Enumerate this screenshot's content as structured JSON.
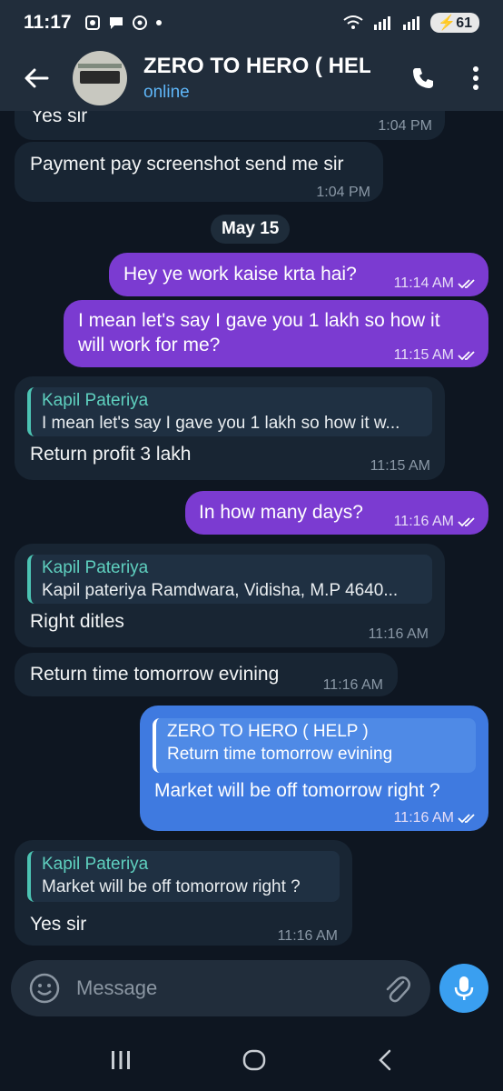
{
  "status_bar": {
    "time": "11:17",
    "battery": "61"
  },
  "header": {
    "title": "ZERO TO HERO ( HEL",
    "status": "online"
  },
  "date_chip": "May 15",
  "messages": [
    {
      "text": "Yes sir",
      "time": "1:04 PM"
    },
    {
      "text": "Payment pay screenshot send me sir",
      "time": "1:04 PM"
    },
    {
      "text": "Hey ye work kaise krta hai?",
      "time": "11:14 AM"
    },
    {
      "text_line1": "I mean let's say I gave you 1 lakh so how it",
      "text_line2": "will work for me?",
      "time": "11:15 AM"
    },
    {
      "quote_name": "Kapil Pateriya",
      "quote_text": "I mean let's say I gave you 1 lakh so how it w...",
      "text": "Return profit 3 lakh",
      "time": "11:15 AM"
    },
    {
      "text": "In how many days?",
      "time": "11:16 AM"
    },
    {
      "quote_name": "Kapil Pateriya",
      "quote_text": "Kapil pateriya Ramdwara, Vidisha, M.P 4640...",
      "text": "Right ditles",
      "time": "11:16 AM"
    },
    {
      "text": "Return time tomorrow evining",
      "time": "11:16 AM"
    },
    {
      "quote_name": "ZERO TO HERO ( HELP )",
      "quote_text": "Return time tomorrow evining",
      "text": "Market will be off tomorrow right ?",
      "time": "11:16 AM"
    },
    {
      "quote_name": "Kapil Pateriya",
      "quote_text": "Market will be off tomorrow right ?",
      "text": "Yes sir",
      "time": "11:16 AM"
    }
  ],
  "composer": {
    "placeholder": "Message"
  },
  "colors": {
    "outgoing_purple": "#7b3bd1",
    "outgoing_blue": "#3f7ae0",
    "incoming": "#182533",
    "accent": "#5eb5f7"
  }
}
